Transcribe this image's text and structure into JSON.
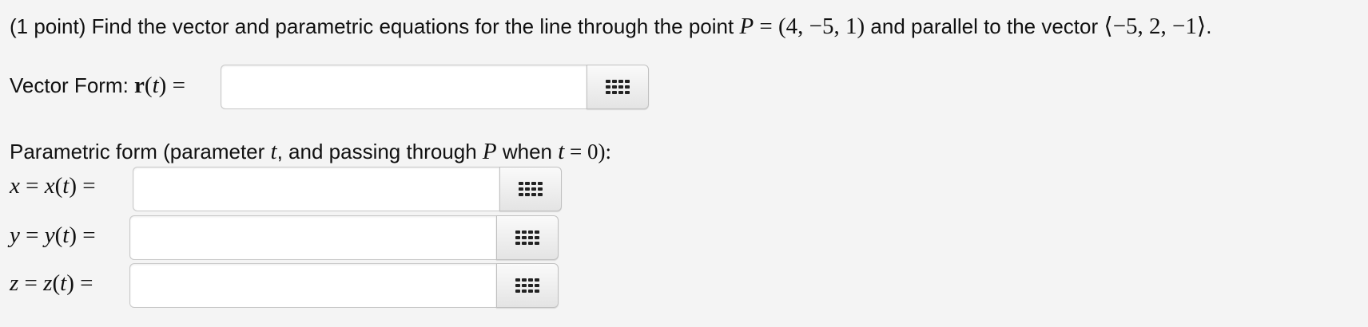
{
  "question": {
    "prefix": "(1 point) Find the vector and parametric equations for the line through the point ",
    "point_var": "P",
    "eq": " = ",
    "point_value": "(4, −5, 1)",
    "middle": " and parallel to the vector ",
    "vector_value": "⟨−5, 2, −1⟩",
    "end": "."
  },
  "vector_form": {
    "label": "Vector Form: ",
    "r": "r",
    "open": "(",
    "t": "t",
    "close": ")",
    "eq": " =",
    "input_value": "",
    "button_icon": "matrix-grid-icon"
  },
  "parametric": {
    "label_a": "Parametric form (parameter ",
    "t1": "t",
    "label_b": ", and passing through ",
    "p": "P",
    "label_c": " when ",
    "t2": "t",
    "label_d": " = 0):",
    "rows": [
      {
        "var": "x",
        "func": "x",
        "input_value": "",
        "button_icon": "matrix-grid-icon"
      },
      {
        "var": "y",
        "func": "y",
        "input_value": "",
        "button_icon": "matrix-grid-icon"
      },
      {
        "var": "z",
        "func": "z",
        "input_value": "",
        "button_icon": "matrix-grid-icon"
      }
    ]
  }
}
